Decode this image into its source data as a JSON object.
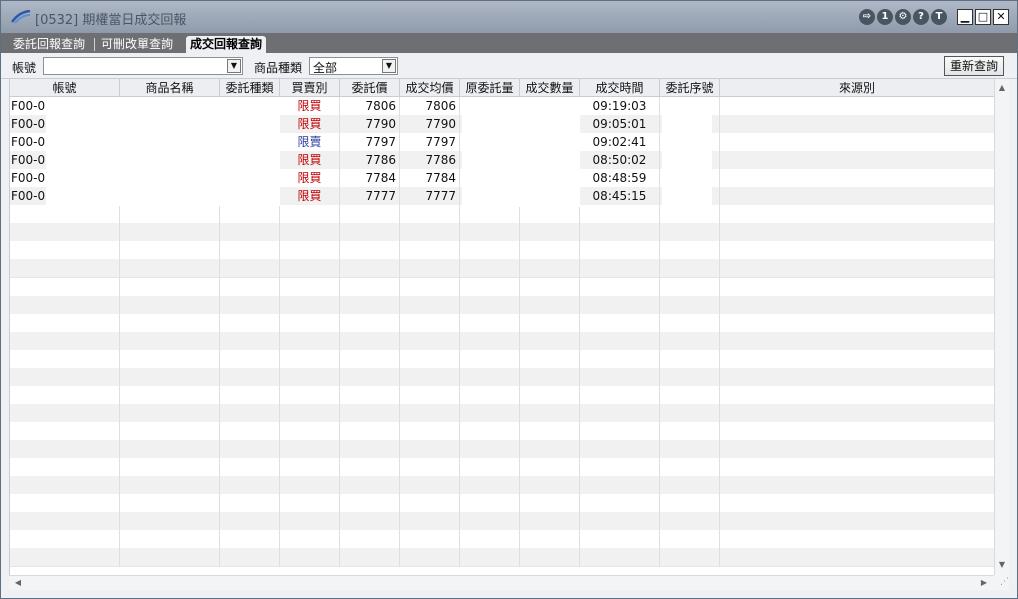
{
  "window": {
    "title": "[0532] 期權當日成交回報",
    "toolbar_icons": [
      {
        "name": "export-icon",
        "glyph": "⇨"
      },
      {
        "name": "one-icon",
        "glyph": "1"
      },
      {
        "name": "settings-icon",
        "glyph": "⚙"
      },
      {
        "name": "help-icon",
        "glyph": "?"
      },
      {
        "name": "t-icon",
        "glyph": "T"
      }
    ],
    "controls": {
      "minimize": "▁",
      "maximize": "□",
      "close": "✕"
    }
  },
  "tabs": [
    {
      "label": "委託回報查詢",
      "active": false
    },
    {
      "label": "可刪改單查詢",
      "active": false
    },
    {
      "label": "成交回報查詢",
      "active": true
    }
  ],
  "filters": {
    "account_label": "帳號",
    "account_value": "",
    "product_type_label": "商品種類",
    "product_type_value": "全部",
    "requery_label": "重新查詢"
  },
  "table": {
    "headers": [
      "帳號",
      "商品名稱",
      "委託種類",
      "買賣別",
      "委託價",
      "成交均價",
      "原委託量",
      "成交數量",
      "成交時間",
      "委託序號",
      "來源別"
    ],
    "rows": [
      {
        "account": "F00-0",
        "product": "",
        "order_type": "",
        "side": "限買",
        "order_price": "7806",
        "avg_price": "7806",
        "orig_qty": "",
        "fill_qty": "",
        "time": "09:19:03",
        "seq": "",
        "source": ""
      },
      {
        "account": "F00-0",
        "product": "",
        "order_type": "",
        "side": "限買",
        "order_price": "7790",
        "avg_price": "7790",
        "orig_qty": "",
        "fill_qty": "",
        "time": "09:05:01",
        "seq": "",
        "source": ""
      },
      {
        "account": "F00-0",
        "product": "",
        "order_type": "",
        "side": "限賣",
        "order_price": "7797",
        "avg_price": "7797",
        "orig_qty": "",
        "fill_qty": "",
        "time": "09:02:41",
        "seq": "",
        "source": ""
      },
      {
        "account": "F00-0",
        "product": "",
        "order_type": "",
        "side": "限買",
        "order_price": "7786",
        "avg_price": "7786",
        "orig_qty": "",
        "fill_qty": "",
        "time": "08:50:02",
        "seq": "",
        "source": ""
      },
      {
        "account": "F00-0",
        "product": "",
        "order_type": "",
        "side": "限買",
        "order_price": "7784",
        "avg_price": "7784",
        "orig_qty": "",
        "fill_qty": "",
        "time": "08:48:59",
        "seq": "",
        "source": ""
      },
      {
        "account": "F00-0",
        "product": "",
        "order_type": "",
        "side": "限買",
        "order_price": "7777",
        "avg_price": "7777",
        "orig_qty": "",
        "fill_qty": "",
        "time": "08:45:15",
        "seq": "",
        "source": ""
      }
    ]
  },
  "colors": {
    "buy": "#c00000",
    "sell": "#2a3aa0",
    "tabbar": "#6d6f73"
  }
}
